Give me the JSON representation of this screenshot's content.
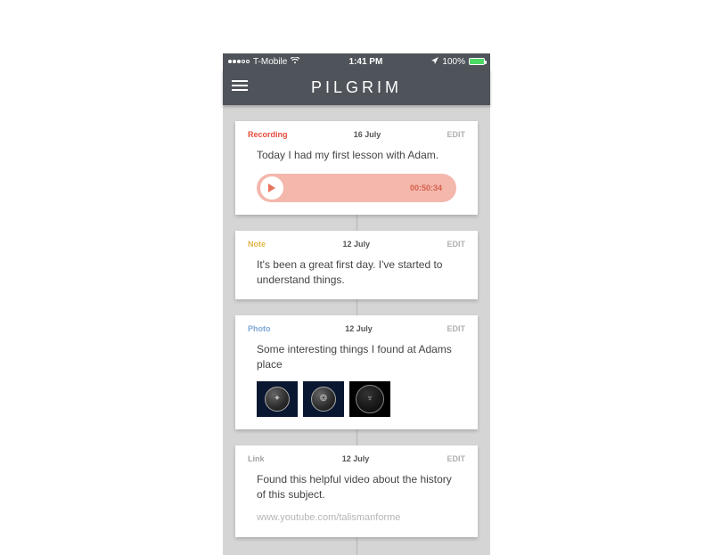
{
  "status": {
    "carrier": "T-Mobile",
    "time": "1:41 PM",
    "battery_pct": "100%"
  },
  "app": {
    "title": "PILGRIM"
  },
  "entries": [
    {
      "type": "Recording",
      "date": "16 July",
      "edit": "EDIT",
      "text": "Today I had my first lesson with Adam.",
      "audio_duration": "00:50:34"
    },
    {
      "type": "Note",
      "date": "12 July",
      "edit": "EDIT",
      "text": "It's been a great first day. I've started to understand things."
    },
    {
      "type": "Photo",
      "date": "12 July",
      "edit": "EDIT",
      "text": "Some interesting things I found at Adams place"
    },
    {
      "type": "Link",
      "date": "12 July",
      "edit": "EDIT",
      "text": "Found this helpful video about the history of this subject.",
      "url": "www.youtube.com/talismanforme"
    }
  ]
}
